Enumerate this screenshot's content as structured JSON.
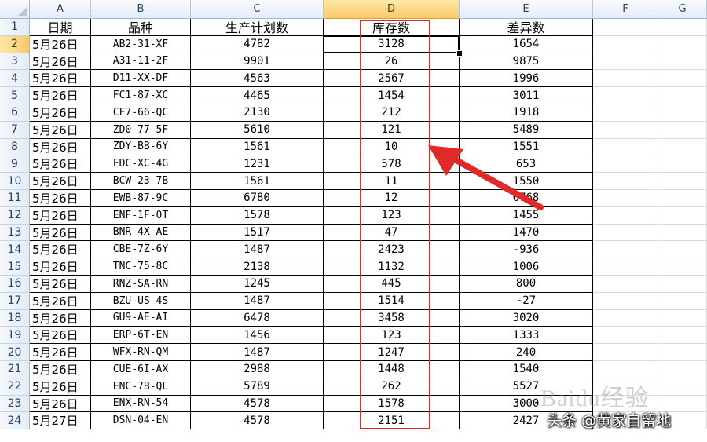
{
  "columns": [
    {
      "letter": "A"
    },
    {
      "letter": "B"
    },
    {
      "letter": "C"
    },
    {
      "letter": "D"
    },
    {
      "letter": "E"
    },
    {
      "letter": "F"
    },
    {
      "letter": "G"
    }
  ],
  "selected_column": "D",
  "selected_row": 2,
  "active_cell": "D2",
  "table": {
    "headers": [
      "日期",
      "品种",
      "生产计划数",
      "库存数",
      "差异数"
    ],
    "rows": [
      {
        "row": 2,
        "date": "5月26日",
        "item": "AB2-31-XF",
        "plan": "4782",
        "stock": "3128",
        "diff": "1654"
      },
      {
        "row": 3,
        "date": "5月26日",
        "item": "A31-11-2F",
        "plan": "9901",
        "stock": "26",
        "diff": "9875"
      },
      {
        "row": 4,
        "date": "5月26日",
        "item": "D11-XX-DF",
        "plan": "4563",
        "stock": "2567",
        "diff": "1996"
      },
      {
        "row": 5,
        "date": "5月26日",
        "item": "FC1-87-XC",
        "plan": "4465",
        "stock": "1454",
        "diff": "3011"
      },
      {
        "row": 6,
        "date": "5月26日",
        "item": "CF7-66-QC",
        "plan": "2130",
        "stock": "212",
        "diff": "1918"
      },
      {
        "row": 7,
        "date": "5月26日",
        "item": "ZD0-77-5F",
        "plan": "5610",
        "stock": "121",
        "diff": "5489"
      },
      {
        "row": 8,
        "date": "5月26日",
        "item": "ZDY-BB-6Y",
        "plan": "1561",
        "stock": "10",
        "diff": "1551"
      },
      {
        "row": 9,
        "date": "5月26日",
        "item": "FDC-XC-4G",
        "plan": "1231",
        "stock": "578",
        "diff": "653"
      },
      {
        "row": 10,
        "date": "5月26日",
        "item": "BCW-23-7B",
        "plan": "1561",
        "stock": "11",
        "diff": "1550"
      },
      {
        "row": 11,
        "date": "5月26日",
        "item": "EWB-87-9C",
        "plan": "6780",
        "stock": "12",
        "diff": "6768"
      },
      {
        "row": 12,
        "date": "5月26日",
        "item": "ENF-1F-0T",
        "plan": "1578",
        "stock": "123",
        "diff": "1455"
      },
      {
        "row": 13,
        "date": "5月26日",
        "item": "BNR-4X-AE",
        "plan": "1517",
        "stock": "47",
        "diff": "1470"
      },
      {
        "row": 14,
        "date": "5月26日",
        "item": "CBE-7Z-6Y",
        "plan": "1487",
        "stock": "2423",
        "diff": "-936"
      },
      {
        "row": 15,
        "date": "5月26日",
        "item": "TNC-75-8C",
        "plan": "2138",
        "stock": "1132",
        "diff": "1006"
      },
      {
        "row": 16,
        "date": "5月26日",
        "item": "RNZ-SA-RN",
        "plan": "1245",
        "stock": "445",
        "diff": "800"
      },
      {
        "row": 17,
        "date": "5月26日",
        "item": "BZU-US-4S",
        "plan": "1487",
        "stock": "1514",
        "diff": "-27"
      },
      {
        "row": 18,
        "date": "5月26日",
        "item": "GU9-AE-AI",
        "plan": "6478",
        "stock": "3458",
        "diff": "3020"
      },
      {
        "row": 19,
        "date": "5月26日",
        "item": "ERP-6T-EN",
        "plan": "1456",
        "stock": "123",
        "diff": "1333"
      },
      {
        "row": 20,
        "date": "5月26日",
        "item": "WFX-RN-QM",
        "plan": "1487",
        "stock": "1247",
        "diff": "240"
      },
      {
        "row": 21,
        "date": "5月26日",
        "item": "CUE-6I-AX",
        "plan": "2988",
        "stock": "1448",
        "diff": "1540"
      },
      {
        "row": 22,
        "date": "5月26日",
        "item": "ENC-7B-QL",
        "plan": "5789",
        "stock": "262",
        "diff": "5527"
      },
      {
        "row": 23,
        "date": "5月26日",
        "item": "ENX-RN-54",
        "plan": "4578",
        "stock": "1578",
        "diff": "3000"
      },
      {
        "row": 24,
        "date": "5月27日",
        "item": "DSN-04-EN",
        "plan": "4578",
        "stock": "2151",
        "diff": "2427"
      }
    ]
  },
  "annotation": {
    "highlight_color": "#e02a2a",
    "highlight_column": "D",
    "arrow_icon": "red-arrow-icon"
  },
  "watermarks": {
    "baidu": "Baidu经验",
    "source": "头条 @黄家自留地"
  }
}
